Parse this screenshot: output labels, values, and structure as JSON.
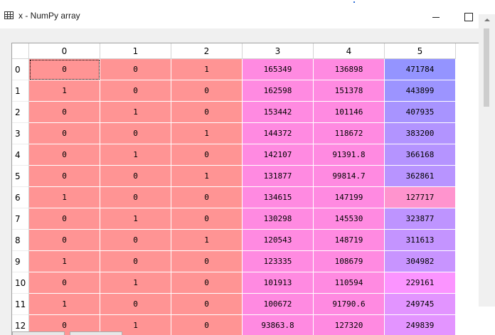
{
  "window": {
    "title": "x - NumPy array"
  },
  "table": {
    "columns": [
      "0",
      "1",
      "2",
      "3",
      "4",
      "5"
    ],
    "rows": [
      {
        "index": "0",
        "cells": [
          "0",
          "0",
          "1",
          "165349",
          "136898",
          "471784"
        ]
      },
      {
        "index": "1",
        "cells": [
          "1",
          "0",
          "0",
          "162598",
          "151378",
          "443899"
        ]
      },
      {
        "index": "2",
        "cells": [
          "0",
          "1",
          "0",
          "153442",
          "101146",
          "407935"
        ]
      },
      {
        "index": "3",
        "cells": [
          "0",
          "0",
          "1",
          "144372",
          "118672",
          "383200"
        ]
      },
      {
        "index": "4",
        "cells": [
          "0",
          "1",
          "0",
          "142107",
          "91391.8",
          "366168"
        ]
      },
      {
        "index": "5",
        "cells": [
          "0",
          "0",
          "1",
          "131877",
          "99814.7",
          "362861"
        ]
      },
      {
        "index": "6",
        "cells": [
          "1",
          "0",
          "0",
          "134615",
          "147199",
          "127717"
        ]
      },
      {
        "index": "7",
        "cells": [
          "0",
          "1",
          "0",
          "130298",
          "145530",
          "323877"
        ]
      },
      {
        "index": "8",
        "cells": [
          "0",
          "0",
          "1",
          "120543",
          "148719",
          "311613"
        ]
      },
      {
        "index": "9",
        "cells": [
          "1",
          "0",
          "0",
          "123335",
          "108679",
          "304982"
        ]
      },
      {
        "index": "10",
        "cells": [
          "0",
          "1",
          "0",
          "101913",
          "110594",
          "229161"
        ]
      },
      {
        "index": "11",
        "cells": [
          "1",
          "0",
          "0",
          "100672",
          "91790.6",
          "249745"
        ]
      },
      {
        "index": "12",
        "cells": [
          "0",
          "1",
          "0",
          "93863.8",
          "127320",
          "249839"
        ]
      }
    ],
    "cell_colors": [
      [
        "#ff9494",
        "#ff9494",
        "#ff9494",
        "#ff8ae1",
        "#ff8ae1",
        "#9494ff"
      ],
      [
        "#ff9494",
        "#ff9494",
        "#ff9494",
        "#ff8ae1",
        "#ff8ae1",
        "#9c94ff"
      ],
      [
        "#ff9494",
        "#ff9494",
        "#ff9494",
        "#ff8ae1",
        "#ff8ae1",
        "#a894ff"
      ],
      [
        "#ff9494",
        "#ff9494",
        "#ff9494",
        "#ff8ae1",
        "#ff8ae1",
        "#b294ff"
      ],
      [
        "#ff9494",
        "#ff9494",
        "#ff9494",
        "#ff8ae1",
        "#ff8ae1",
        "#b594ff"
      ],
      [
        "#ff9494",
        "#ff9494",
        "#ff9494",
        "#ff8ae1",
        "#ff8ae1",
        "#b894ff"
      ],
      [
        "#ff9494",
        "#ff9494",
        "#ff9494",
        "#ff8ae1",
        "#ff8ae1",
        "#ff94ce"
      ],
      [
        "#ff9494",
        "#ff9494",
        "#ff9494",
        "#ff8ae1",
        "#ff8ae1",
        "#be94ff"
      ],
      [
        "#ff9494",
        "#ff9494",
        "#ff9494",
        "#ff8ae1",
        "#ff8ae1",
        "#c494ff"
      ],
      [
        "#ff9494",
        "#ff9494",
        "#ff9494",
        "#ff8ae1",
        "#ff8ae1",
        "#c894ff"
      ],
      [
        "#ff9494",
        "#ff9494",
        "#ff9494",
        "#ff8ae1",
        "#ff8ae1",
        "#fb94ff"
      ],
      [
        "#ff9494",
        "#ff9494",
        "#ff9494",
        "#ff8ae1",
        "#ff8ae1",
        "#e294ff"
      ],
      [
        "#ff9494",
        "#ff9494",
        "#ff9494",
        "#ff8ae1",
        "#ff8ae1",
        "#e394ff"
      ]
    ],
    "selected_cell": "0,0"
  },
  "icons": {
    "title": "table-grid-icon",
    "minimize": "minimize-icon",
    "maximize": "maximize-icon"
  }
}
